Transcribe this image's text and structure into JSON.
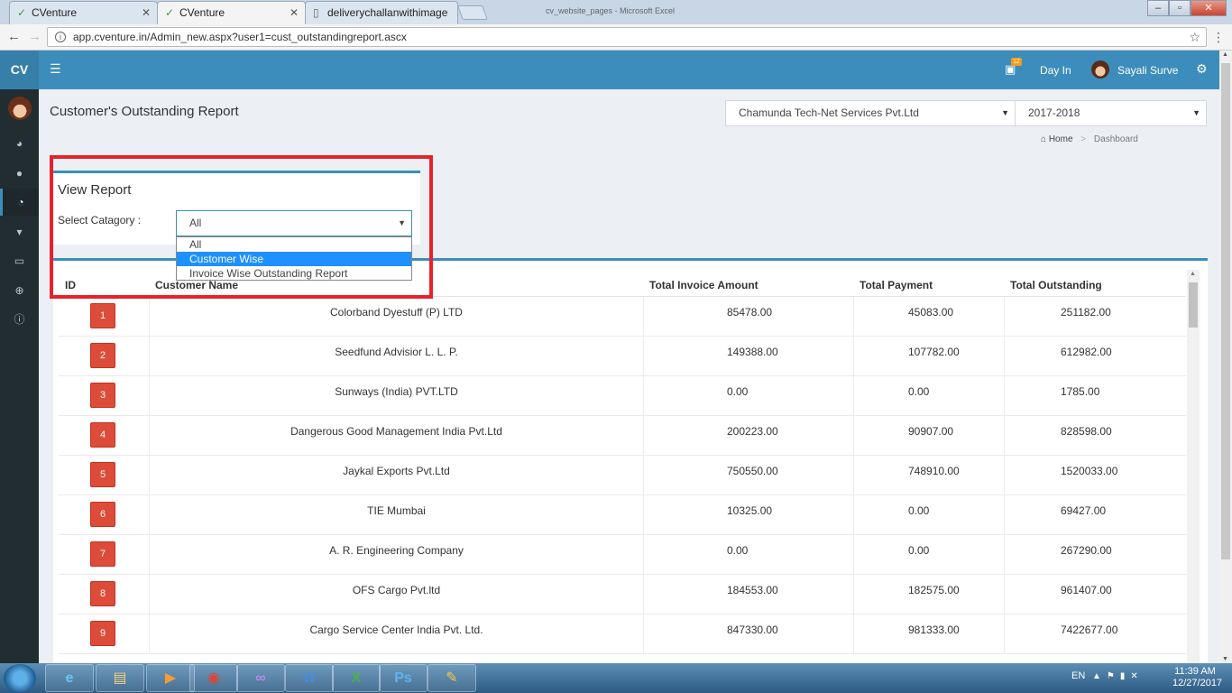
{
  "browser": {
    "tabs": [
      {
        "label": "CVenture",
        "icon": "cventure-favicon"
      },
      {
        "label": "CVenture",
        "icon": "cventure-favicon"
      },
      {
        "label": "deliverychallanwithimage",
        "icon": "doc-icon"
      }
    ],
    "url": "app.cventure.in/Admin_new.aspx?user1=cust_outstandingreport.ascx",
    "window_title": "cv_website_pages - Microsoft Excel"
  },
  "header": {
    "logo": "CV",
    "badge": "12",
    "day_in": "Day In",
    "user_name": "Sayali Surve"
  },
  "page": {
    "title": "Customer's Outstanding Report",
    "company": "Chamunda Tech-Net Services Pvt.Ltd",
    "year": "2017-2018",
    "breadcrumb": {
      "home": "Home",
      "current": "Dashboard"
    }
  },
  "view_report": {
    "title": "View Report",
    "label": "Select Catagory :",
    "selected": "All",
    "options": [
      "All",
      "Customer Wise",
      "Invoice Wise Outstanding Report"
    ],
    "highlighted_option": "Customer Wise"
  },
  "table": {
    "headers": {
      "id": "ID",
      "name": "Customer Name",
      "invoice": "Total Invoice Amount",
      "payment": "Total Payment",
      "outstanding": "Total Outstanding"
    },
    "rows": [
      {
        "id": "1",
        "name": "Colorband Dyestuff (P) LTD",
        "invoice": "85478.00",
        "payment": "45083.00",
        "outstanding": "251182.00"
      },
      {
        "id": "2",
        "name": "Seedfund Advisior L. L. P.",
        "invoice": "149388.00",
        "payment": "107782.00",
        "outstanding": "612982.00"
      },
      {
        "id": "3",
        "name": "Sunways (India) PVT.LTD",
        "invoice": "0.00",
        "payment": "0.00",
        "outstanding": "1785.00"
      },
      {
        "id": "4",
        "name": "Dangerous Good Management India Pvt.Ltd",
        "invoice": "200223.00",
        "payment": "90907.00",
        "outstanding": "828598.00"
      },
      {
        "id": "5",
        "name": "Jaykal Exports Pvt.Ltd",
        "invoice": "750550.00",
        "payment": "748910.00",
        "outstanding": "1520033.00"
      },
      {
        "id": "6",
        "name": "TIE Mumbai",
        "invoice": "10325.00",
        "payment": "0.00",
        "outstanding": "69427.00"
      },
      {
        "id": "7",
        "name": "A. R. Engineering Company",
        "invoice": "0.00",
        "payment": "0.00",
        "outstanding": "267290.00"
      },
      {
        "id": "8",
        "name": "OFS Cargo Pvt.ltd",
        "invoice": "184553.00",
        "payment": "182575.00",
        "outstanding": "961407.00"
      },
      {
        "id": "9",
        "name": "Cargo Service Center India Pvt. Ltd.",
        "invoice": "847330.00",
        "payment": "981333.00",
        "outstanding": "7422677.00"
      }
    ]
  },
  "taskbar": {
    "lang": "EN",
    "time": "11:39 AM",
    "date": "12/27/2017",
    "apps": [
      "ie-icon",
      "explorer-icon",
      "media-player-icon",
      "chrome-icon",
      "visual-studio-icon",
      "word-icon",
      "excel-icon",
      "photoshop-icon",
      "paint-icon"
    ]
  },
  "colors": {
    "accent": "#3c8dbc",
    "id_badge": "#dd4b39",
    "highlight_frame": "#e8222b",
    "sidebar": "#222d32"
  }
}
